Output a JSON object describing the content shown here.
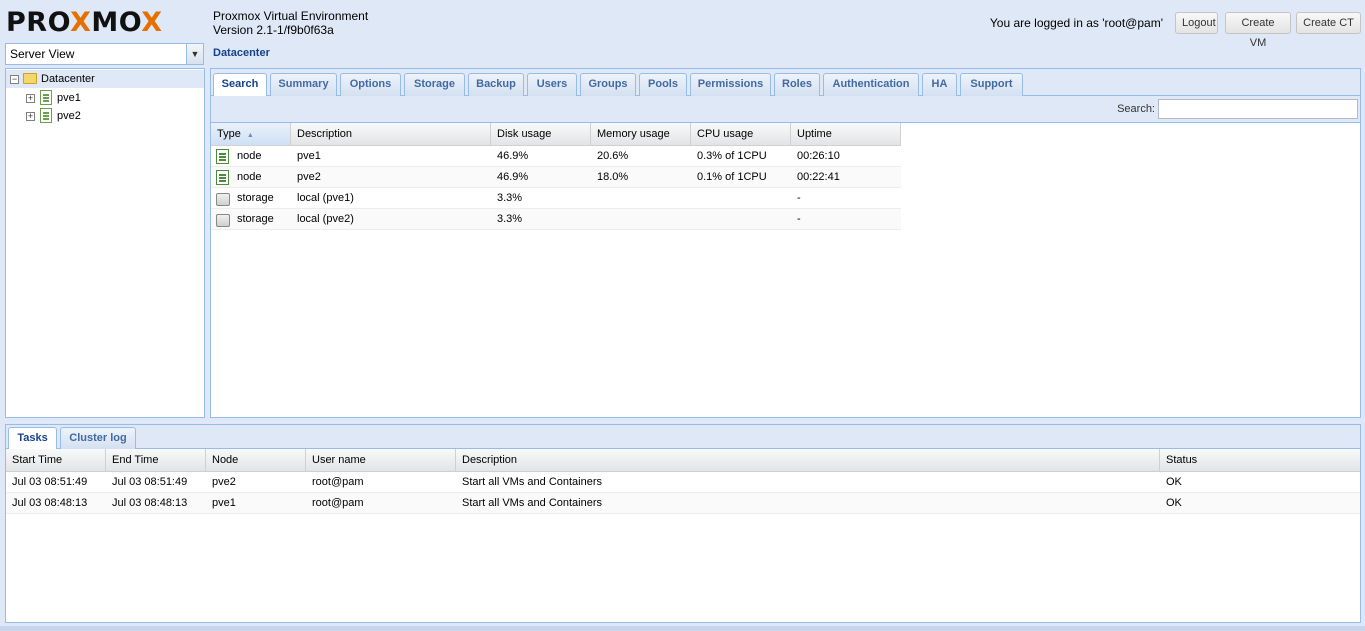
{
  "header": {
    "logo_pre": "PRO",
    "logo_x1": "X",
    "logo_mid": "MO",
    "logo_x2": "X",
    "app_name": "Proxmox Virtual Environment",
    "version": "Version 2.1-1/f9b0f63a",
    "logged_in": "You are logged in as 'root@pam'",
    "logout": "Logout",
    "create_vm": "Create VM",
    "create_ct": "Create CT"
  },
  "sidebar": {
    "view_value": "Server View",
    "tree": [
      {
        "label": "Datacenter",
        "expander": "−"
      },
      {
        "label": "pve1",
        "expander": "+"
      },
      {
        "label": "pve2",
        "expander": "+"
      }
    ]
  },
  "content": {
    "title": "Datacenter",
    "tabs": [
      "Search",
      "Summary",
      "Options",
      "Storage",
      "Backup",
      "Users",
      "Groups",
      "Pools",
      "Permissions",
      "Roles",
      "Authentication",
      "HA",
      "Support"
    ],
    "search_label": "Search:",
    "search_value": "",
    "columns": [
      "Type",
      "Description",
      "Disk usage",
      "Memory usage",
      "CPU usage",
      "Uptime"
    ],
    "sort_indicator": "▲",
    "rows": [
      {
        "icon": "server-icon",
        "type": "node",
        "description": "pve1",
        "disk": "46.9%",
        "memory": "20.6%",
        "cpu": "0.3% of 1CPU",
        "uptime": "00:26:10"
      },
      {
        "icon": "server-icon",
        "type": "node",
        "description": "pve2",
        "disk": "46.9%",
        "memory": "18.0%",
        "cpu": "0.1% of 1CPU",
        "uptime": "00:22:41"
      },
      {
        "icon": "storage-icon",
        "type": "storage",
        "description": "local (pve1)",
        "disk": "3.3%",
        "memory": "",
        "cpu": "",
        "uptime": "-"
      },
      {
        "icon": "storage-icon",
        "type": "storage",
        "description": "local (pve2)",
        "disk": "3.3%",
        "memory": "",
        "cpu": "",
        "uptime": "-"
      }
    ]
  },
  "log_panel": {
    "tabs": [
      "Tasks",
      "Cluster log"
    ],
    "columns": [
      "Start Time",
      "End Time",
      "Node",
      "User name",
      "Description",
      "Status"
    ],
    "rows": [
      {
        "start": "Jul 03 08:51:49",
        "end": "Jul 03 08:51:49",
        "node": "pve2",
        "user": "root@pam",
        "description": "Start all VMs and Containers",
        "status": "OK"
      },
      {
        "start": "Jul 03 08:48:13",
        "end": "Jul 03 08:48:13",
        "node": "pve1",
        "user": "root@pam",
        "description": "Start all VMs and Containers",
        "status": "OK"
      }
    ]
  },
  "colors": {
    "logo_x": "#e57000",
    "panel_border": "#99bbe8",
    "tab_text": "#15428b"
  }
}
